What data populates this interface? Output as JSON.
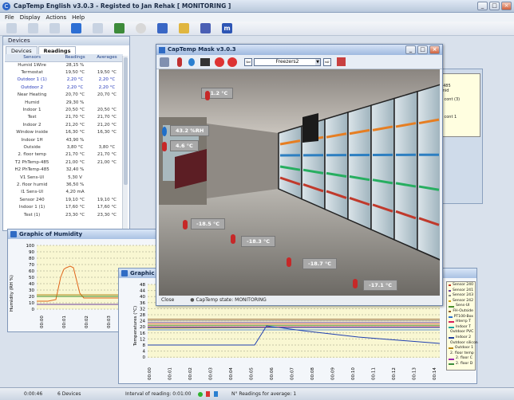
{
  "window": {
    "title": "CapTemp English   v3.0.3   - Registed to Jan Rehak     [ MONITORING ]"
  },
  "menu": [
    "File",
    "Display",
    "Actions",
    "Help"
  ],
  "devices_panel": {
    "title": "Devices",
    "tabs": [
      "Devices",
      "Readings"
    ],
    "active_tab": "Readings",
    "columns": [
      "Sensors",
      "Readings",
      "Averages"
    ],
    "rows": [
      [
        "Humid 1Wire",
        "28,15 %",
        ""
      ],
      [
        "Termostat",
        "19,50 °C",
        "19,50 °C"
      ],
      [
        "Outdoor 1 (1)",
        "2,20 °C",
        "2,20 °C"
      ],
      [
        "Outdoor 2",
        "2,20 °C",
        "2,20 °C"
      ],
      [
        "Near Heating",
        "20,70 °C",
        "20,70 °C"
      ],
      [
        "Humid",
        "29,30 %",
        ""
      ],
      [
        "Indoor 1",
        "20,50 °C",
        "20,50 °C"
      ],
      [
        "Test",
        "21,70 °C",
        "21,70 °C"
      ],
      [
        "Indoor 2",
        "21,20 °C",
        "21,20 °C"
      ],
      [
        "Window inside",
        "16,30 °C",
        "16,30 °C"
      ],
      [
        "Indoor 1H",
        "43,90 %",
        ""
      ],
      [
        "Outside",
        "3,80 °C",
        "3,80 °C"
      ],
      [
        "2. floor temp",
        "21,70 °C",
        "21,70 °C"
      ],
      [
        "T2 PhTemp-485",
        "21,00 °C",
        "21,00 °C"
      ],
      [
        "H2 PhTemp-485",
        "32,40 %",
        ""
      ],
      [
        "V1 Sens-UI",
        "5,30 V",
        ""
      ],
      [
        "2. floor humid",
        "36,50 %",
        ""
      ],
      [
        "I1 Sens-UI",
        "4,20 mA",
        ""
      ],
      [
        "Sensor 240",
        "19,10 °C",
        "19,10 °C"
      ],
      [
        "Indoor 1 (1)",
        "17,60 °C",
        "17,60 °C"
      ],
      [
        "Test (1)",
        "23,30 °C",
        "23,30 °C"
      ]
    ]
  },
  "humidity_graph": {
    "title": "Graphic of Humidity",
    "ylabel": "Humidity (RH %)",
    "yticks": [
      "100",
      "90",
      "80",
      "70",
      "60",
      "50",
      "40",
      "30",
      "20",
      "10",
      "0"
    ],
    "xticks": [
      "00:00",
      "00:01",
      "00:02",
      "00:03"
    ]
  },
  "temp_graph": {
    "title": "Graphic of T",
    "ylabel": "Temperatures (°C)",
    "yticks": [
      "48",
      "44",
      "40",
      "36",
      "32",
      "28",
      "24",
      "20",
      "16",
      "12",
      "8",
      "4",
      "0"
    ],
    "xticks": [
      "00:00",
      "00:01",
      "00:02",
      "00:03",
      "00:04",
      "00:05",
      "00:06",
      "00:07",
      "00:08",
      "00:09",
      "00:10",
      "00:11",
      "00:12",
      "00:13",
      "00:14"
    ],
    "legend": [
      "Sensor 240",
      "Sensor 241",
      "Sensor 243",
      "Sensor 242",
      "Sens-UI",
      "FH-Outside",
      "PT100-Box",
      "Hterrp T",
      "Indoor T",
      "Outdoor PVC",
      "Indoor 2",
      "Outdoor silicon",
      "Outdoor 1",
      "2. floor temp",
      "2. floor C",
      "2. floor D"
    ],
    "legend_colors": [
      "#c0392b",
      "#6b3fa0",
      "#888888",
      "#d4a017",
      "#4a8f2c",
      "#8b5a2b",
      "#2a6fd1",
      "#d81e5b",
      "#15a3a3",
      "#e67e22",
      "#1f3f9f",
      "#777777",
      "#b8860b",
      "#555555",
      "#9c27b0",
      "#3b8d3b"
    ]
  },
  "capmask": {
    "title": "CapTemp Mask   v3.0.3",
    "select_value": "Freezers2",
    "labels": [
      "21.2 °C",
      "43.2 %RH",
      "4.6 °C",
      "-18.5 °C",
      "-18.3 °C",
      "-18.7 °C",
      "-17.1 °C"
    ],
    "close_label": "Close",
    "status_label": "CapTemp state: MONITORING"
  },
  "bg_legend": [
    "1Wire",
    "",
    "1H",
    "Temp-485",
    "or humid",
    "r H2",
    "er dry cont (3)",
    "or 23",
    "t 1",
    "H2 1",
    "er dry cont 1",
    "r 23.1"
  ],
  "statusbar": {
    "time": "0:00:46",
    "devices": "6 Devices",
    "interval": "Interval of reading: 0:01:00",
    "averages": "N° Readings for average: 1"
  }
}
